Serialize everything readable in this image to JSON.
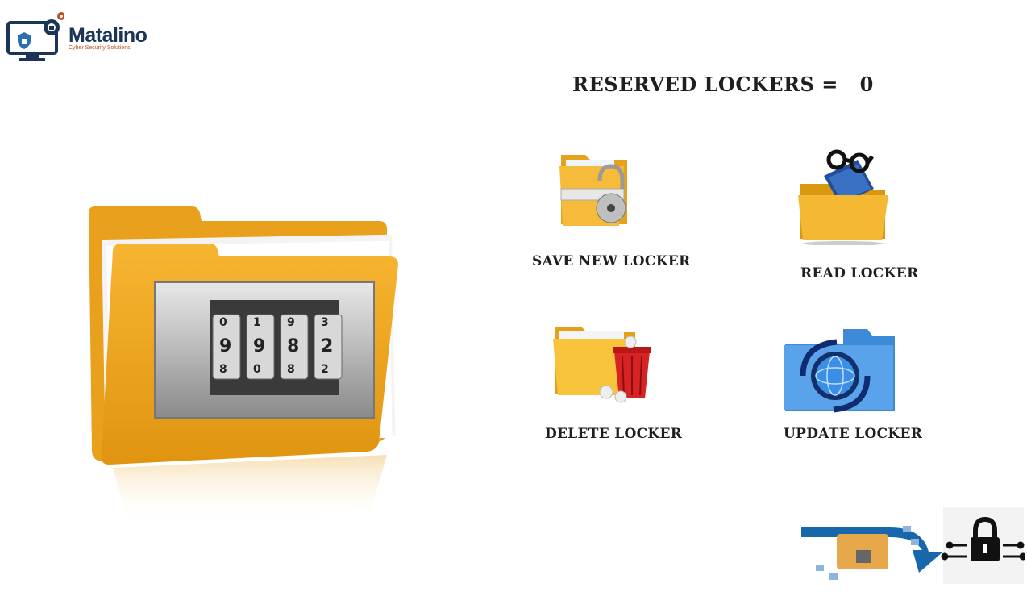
{
  "brand": {
    "name": "Matalino",
    "tagline": "Cyber Security Solutions",
    "colors": {
      "navy": "#1b3558",
      "orange": "#c0501e"
    }
  },
  "reserved": {
    "label": "RESERVED LOCKERS =",
    "count": "0"
  },
  "hero": {
    "icon": "locked-folder-icon",
    "combination_top": [
      "0",
      "1",
      "9",
      "3"
    ],
    "combination_mid": [
      "9",
      "9",
      "8",
      "2"
    ],
    "combination_bot": [
      "8",
      "0",
      "8",
      "2"
    ]
  },
  "actions": [
    {
      "label": "SAVE NEW LOCKER",
      "icon": "folder-padlock-icon"
    },
    {
      "label": "READ LOCKER",
      "icon": "folder-book-glasses-icon"
    },
    {
      "label": "DELETE LOCKER",
      "icon": "folder-trash-icon"
    },
    {
      "label": "UPDATE LOCKER",
      "icon": "folder-sync-globe-icon"
    }
  ],
  "colors": {
    "folder": "#f2a81d",
    "folder_dark": "#c8820d",
    "blue": "#1b6fa8"
  }
}
